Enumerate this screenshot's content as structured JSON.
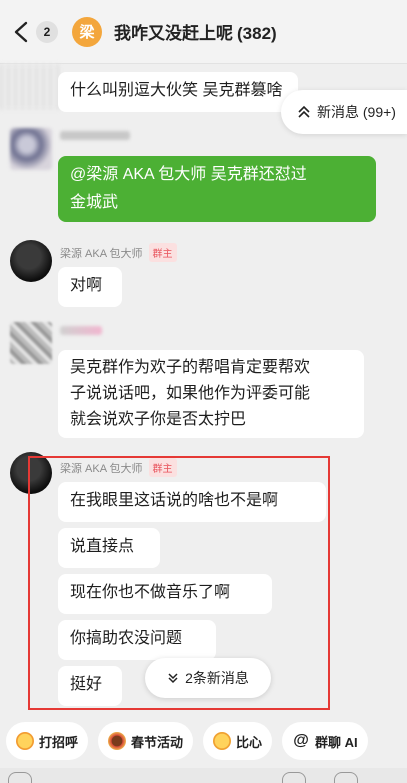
{
  "header": {
    "unread_count": "2",
    "group_avatar_text": "梁",
    "group_name": "我咋又没赶上呢",
    "member_count": "(382)"
  },
  "new_messages_top": "新消息 (99+)",
  "messages": [
    {
      "text": "什么叫别逗大伙笑 吴克群篡啥"
    },
    {
      "text_line1": "@梁源 AKA 包大师 吴克群还怼过",
      "text_line2": "金城武"
    },
    {
      "sender": "梁源 AKA 包大师",
      "badge": "群主",
      "text": "对啊"
    },
    {
      "text_line1": "吴克群作为欢子的帮唱肯定要帮欢",
      "text_line2": "子说说话吧，如果他作为评委可能",
      "text_line3": "就会说欢子你是否太拧巴"
    },
    {
      "sender": "梁源 AKA 包大师",
      "badge": "群主",
      "texts": [
        "在我眼里这话说的啥也不是啊",
        "说直接点",
        "现在你也不做音乐了啊",
        "你搞助农没问题",
        "挺好"
      ]
    }
  ],
  "new_messages_bottom": "2条新消息",
  "quick_actions": [
    {
      "label": "打招呼",
      "icon": "wave-emoji-icon"
    },
    {
      "label": "春节活动",
      "icon": "festival-icon"
    },
    {
      "label": "比心",
      "icon": "heart-hands-icon"
    },
    {
      "label": "群聊 AI",
      "icon": "at-icon"
    }
  ],
  "colors": {
    "accent_green": "#4cb034",
    "highlight_red": "#e53935",
    "owner_badge": "#e8525b",
    "group_avatar": "#f3a63c"
  }
}
